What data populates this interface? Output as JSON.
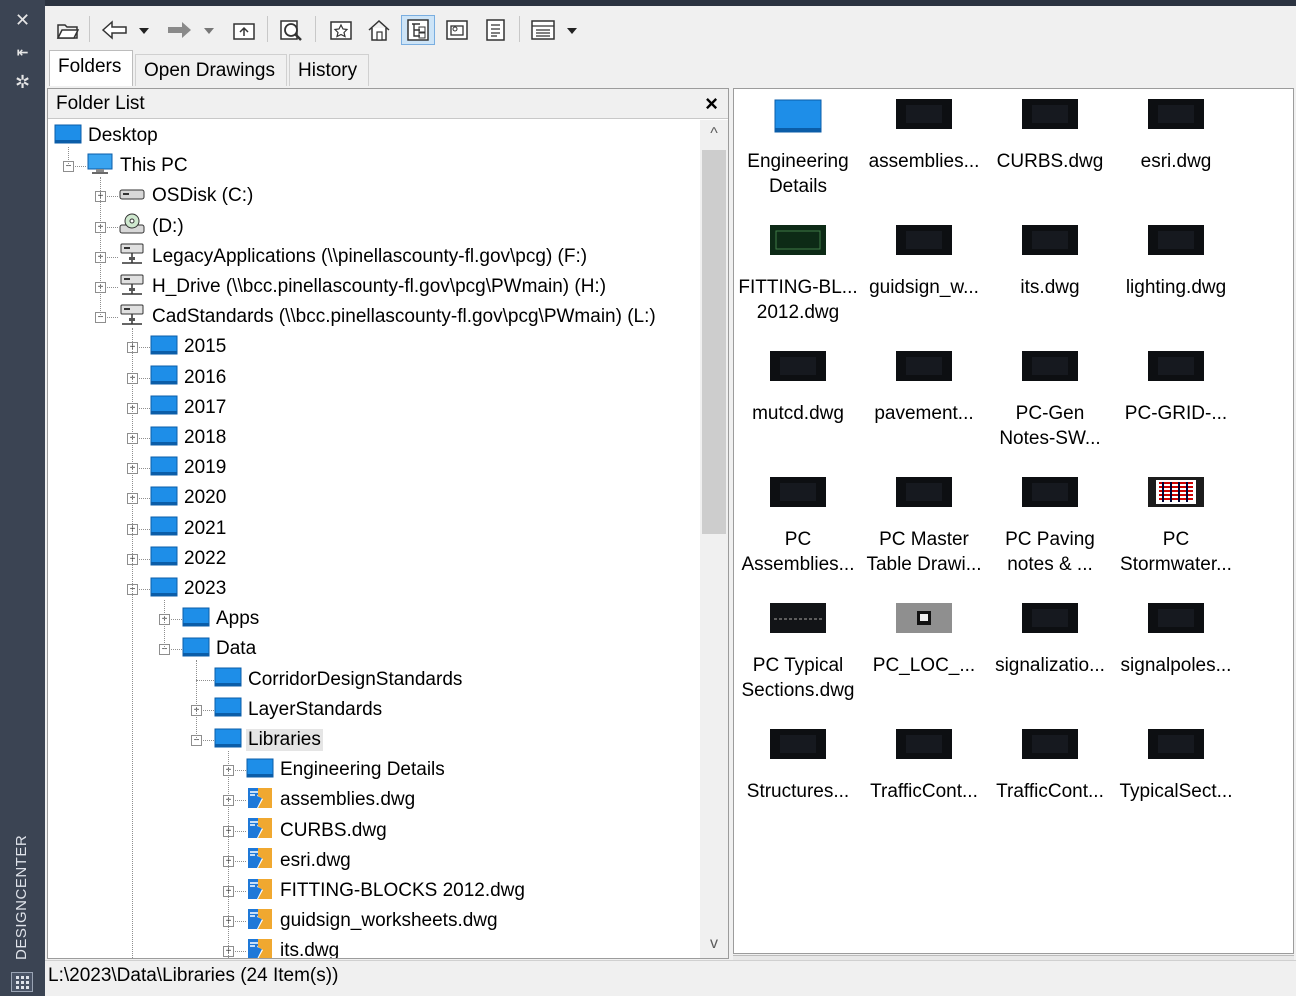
{
  "sidebar": {
    "title": "DESIGNCENTER",
    "close_icon": "close-icon",
    "autohide_icon": "auto-hide-icon",
    "properties_icon": "properties-icon"
  },
  "toolbar": {
    "buttons": [
      "load-icon",
      "back-icon",
      "back-dropdown-icon",
      "forward-icon",
      "forward-dropdown-icon",
      "up-folder-icon",
      "search-icon",
      "favorites-icon",
      "home-icon",
      "tree-view-toggle-icon",
      "preview-icon",
      "description-icon",
      "views-icon",
      "views-dropdown-icon"
    ]
  },
  "tabs": [
    {
      "label": "Folders",
      "active": true
    },
    {
      "label": "Open Drawings",
      "active": false
    },
    {
      "label": "History",
      "active": false
    }
  ],
  "folder_list": {
    "title": "Folder List",
    "close": "×",
    "scroll_up": "^",
    "scroll_down": "v",
    "tree": [
      {
        "label": "Desktop",
        "icon": "desktop-icon",
        "depth": 0,
        "exp": "none"
      },
      {
        "label": "This PC",
        "icon": "computer-icon",
        "depth": 1,
        "exp": "minus"
      },
      {
        "label": "OSDisk (C:)",
        "icon": "drive-icon",
        "depth": 2,
        "exp": "plus"
      },
      {
        "label": "(D:)",
        "icon": "cd-drive-icon",
        "depth": 2,
        "exp": "plus"
      },
      {
        "label": "LegacyApplications (\\\\pinellascounty-fl.gov\\pcg) (F:)",
        "icon": "network-drive-icon",
        "depth": 2,
        "exp": "plus"
      },
      {
        "label": "H_Drive (\\\\bcc.pinellascounty-fl.gov\\pcg\\PWmain) (H:)",
        "icon": "network-drive-icon",
        "depth": 2,
        "exp": "plus"
      },
      {
        "label": "CadStandards (\\\\bcc.pinellascounty-fl.gov\\pcg\\PWmain) (L:)",
        "icon": "network-drive-icon",
        "depth": 2,
        "exp": "minus"
      },
      {
        "label": "2015",
        "icon": "folder-icon",
        "depth": 3,
        "exp": "plus"
      },
      {
        "label": "2016",
        "icon": "folder-icon",
        "depth": 3,
        "exp": "plus"
      },
      {
        "label": "2017",
        "icon": "folder-icon",
        "depth": 3,
        "exp": "plus"
      },
      {
        "label": "2018",
        "icon": "folder-icon",
        "depth": 3,
        "exp": "plus"
      },
      {
        "label": "2019",
        "icon": "folder-icon",
        "depth": 3,
        "exp": "plus"
      },
      {
        "label": "2020",
        "icon": "folder-icon",
        "depth": 3,
        "exp": "plus"
      },
      {
        "label": "2021",
        "icon": "folder-icon",
        "depth": 3,
        "exp": "plus"
      },
      {
        "label": "2022",
        "icon": "folder-icon",
        "depth": 3,
        "exp": "plus"
      },
      {
        "label": "2023",
        "icon": "folder-icon",
        "depth": 3,
        "exp": "minus"
      },
      {
        "label": "Apps",
        "icon": "folder-icon",
        "depth": 4,
        "exp": "plus"
      },
      {
        "label": "Data",
        "icon": "folder-icon",
        "depth": 4,
        "exp": "minus"
      },
      {
        "label": "CorridorDesignStandards",
        "icon": "folder-icon",
        "depth": 5,
        "exp": "none"
      },
      {
        "label": "LayerStandards",
        "icon": "folder-icon",
        "depth": 5,
        "exp": "plus"
      },
      {
        "label": "Libraries",
        "icon": "folder-icon",
        "depth": 5,
        "exp": "minus",
        "selected": true
      },
      {
        "label": "Engineering Details",
        "icon": "folder-icon",
        "depth": 6,
        "exp": "plus"
      },
      {
        "label": "assemblies.dwg",
        "icon": "dwg-file-icon",
        "depth": 6,
        "exp": "plus"
      },
      {
        "label": "CURBS.dwg",
        "icon": "dwg-file-icon",
        "depth": 6,
        "exp": "plus"
      },
      {
        "label": "esri.dwg",
        "icon": "dwg-file-icon",
        "depth": 6,
        "exp": "plus"
      },
      {
        "label": "FITTING-BLOCKS 2012.dwg",
        "icon": "dwg-file-icon",
        "depth": 6,
        "exp": "plus"
      },
      {
        "label": "guidsign_worksheets.dwg",
        "icon": "dwg-file-icon",
        "depth": 6,
        "exp": "plus"
      },
      {
        "label": "its.dwg",
        "icon": "dwg-file-icon",
        "depth": 6,
        "exp": "plus"
      }
    ]
  },
  "content": {
    "items": [
      {
        "label": [
          "Engineering",
          "Details"
        ],
        "thumb": "folder"
      },
      {
        "label": [
          "assemblies..."
        ],
        "thumb": "dwg"
      },
      {
        "label": [
          "CURBS.dwg"
        ],
        "thumb": "dwg"
      },
      {
        "label": [
          "esri.dwg"
        ],
        "thumb": "dwg"
      },
      {
        "label": [
          "FITTING-BL...",
          "2012.dwg"
        ],
        "thumb": "dwg-green"
      },
      {
        "label": [
          "guidsign_w..."
        ],
        "thumb": "dwg"
      },
      {
        "label": [
          "its.dwg"
        ],
        "thumb": "dwg"
      },
      {
        "label": [
          "lighting.dwg"
        ],
        "thumb": "dwg"
      },
      {
        "label": [
          "mutcd.dwg"
        ],
        "thumb": "dwg"
      },
      {
        "label": [
          "pavement..."
        ],
        "thumb": "dwg"
      },
      {
        "label": [
          "PC-Gen",
          "Notes-SW..."
        ],
        "thumb": "dwg"
      },
      {
        "label": [
          "PC-GRID-..."
        ],
        "thumb": "dwg"
      },
      {
        "label": [
          "PC",
          "Assemblies..."
        ],
        "thumb": "dwg"
      },
      {
        "label": [
          "PC Master",
          "Table Drawi..."
        ],
        "thumb": "dwg"
      },
      {
        "label": [
          "PC Paving",
          "notes & ..."
        ],
        "thumb": "dwg"
      },
      {
        "label": [
          "PC",
          "Stormwater..."
        ],
        "thumb": "dwg-color"
      },
      {
        "label": [
          "PC Typical",
          "Sections.dwg"
        ],
        "thumb": "dwg-line"
      },
      {
        "label": [
          "PC_LOC_..."
        ],
        "thumb": "dwg-gray"
      },
      {
        "label": [
          "signalizatio..."
        ],
        "thumb": "dwg"
      },
      {
        "label": [
          "signalpoles..."
        ],
        "thumb": "dwg"
      },
      {
        "label": [
          "Structures..."
        ],
        "thumb": "dwg"
      },
      {
        "label": [
          "TrafficCont..."
        ],
        "thumb": "dwg"
      },
      {
        "label": [
          "TrafficCont..."
        ],
        "thumb": "dwg"
      },
      {
        "label": [
          "TypicalSect..."
        ],
        "thumb": "dwg"
      }
    ]
  },
  "status": {
    "text": "L:\\2023\\Data\\Libraries (24 Item(s))"
  }
}
